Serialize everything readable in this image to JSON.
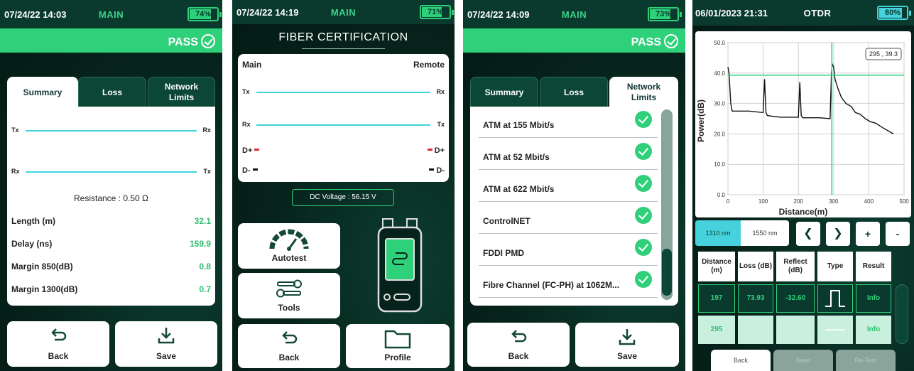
{
  "screen1": {
    "time": "07/24/22 14:03",
    "mode": "MAIN",
    "battery": "74%",
    "battery_level": 0.74,
    "pass": "PASS",
    "tabs": [
      "Summary",
      "Loss",
      "Network Limits"
    ],
    "lines": [
      {
        "left": "Tx",
        "right": "Rx"
      },
      {
        "left": "Rx",
        "right": "Tx"
      }
    ],
    "resistance": "Resistance : 0.50 Ω",
    "metrics": [
      {
        "label": "Length (m)",
        "value": "32.1"
      },
      {
        "label": "Delay (ns)",
        "value": "159.9"
      },
      {
        "label": "Margin 850(dB)",
        "value": "0.8"
      },
      {
        "label": "Margin 1300(dB)",
        "value": "0.7"
      }
    ],
    "back": "Back",
    "save": "Save"
  },
  "screen2": {
    "time": "07/24/22 14:19",
    "mode": "MAIN",
    "battery": "71%",
    "battery_level": 0.71,
    "title": "FIBER CERTIFICATION",
    "main": "Main",
    "remote": "Remote",
    "lines": [
      {
        "left": "Tx",
        "right": "Rx"
      },
      {
        "left": "Rx",
        "right": "Tx"
      }
    ],
    "dplus": "D+",
    "dminus": "D-",
    "dc_voltage": "DC Voltage : 56.15 V",
    "autotest": "Autotest",
    "tools": "Tools",
    "back": "Back",
    "profile": "Profile"
  },
  "screen3": {
    "time": "07/24/22 14:09",
    "mode": "MAIN",
    "battery": "73%",
    "battery_level": 0.73,
    "pass": "PASS",
    "tabs": [
      "Summary",
      "Loss",
      "Network Limits"
    ],
    "items": [
      "ATM at 155 Mbit/s",
      "ATM at 52 Mbit/s",
      "ATM at 622 Mbit/s",
      "ControlNET",
      "FDDI PMD",
      "Fibre Channel (FC-PH) at 1062M..."
    ],
    "back": "Back",
    "save": "Save"
  },
  "screen4": {
    "time": "06/01/2023 21:31",
    "mode": "OTDR",
    "battery": "80%",
    "battery_level": 0.8,
    "cursor_readout": "295 , 39.3",
    "wl_1310": "1310 nm",
    "wl_1550": "1550 nm",
    "prev": "❮",
    "next": "❯",
    "plus": "+",
    "minus": "-",
    "headers": [
      "Distance (m)",
      "Loss (dB)",
      "Reflect (dB)",
      "Type",
      "Result"
    ],
    "row1": [
      "197",
      "73.93",
      "-32.60",
      "",
      "Info"
    ],
    "row2": [
      "295",
      "",
      "",
      "",
      "Info"
    ],
    "back": "Back",
    "save": "Save",
    "retest": "Re-Test"
  },
  "chart_data": {
    "type": "line",
    "xlabel": "Distance(m)",
    "ylabel": "Power(dB)",
    "xlim": [
      0,
      500
    ],
    "ylim": [
      0,
      50
    ],
    "xticks": [
      "0",
      "100",
      "200",
      "300",
      "400",
      "500"
    ],
    "yticks": [
      "0.0",
      "10.0",
      "20.0",
      "30.0",
      "40.0",
      "50.0"
    ],
    "grid": true,
    "cursor": {
      "x": 295,
      "y": 39.3
    },
    "series": [
      {
        "x": [
          0,
          3,
          8,
          12,
          60,
          100,
          104,
          108,
          112,
          150,
          200,
          204,
          208,
          212,
          260,
          290,
          294,
          296,
          300,
          304,
          312,
          322,
          335,
          350,
          362,
          375,
          390,
          405,
          420,
          440,
          455,
          470
        ],
        "y": [
          42,
          40,
          30,
          27.5,
          27.5,
          27,
          38,
          27,
          26,
          25.5,
          25.5,
          37,
          26,
          25.3,
          25.3,
          25,
          40,
          43,
          42,
          38,
          35,
          32,
          30,
          29,
          27,
          26.5,
          25,
          24,
          23.5,
          22,
          21,
          20
        ]
      }
    ]
  }
}
